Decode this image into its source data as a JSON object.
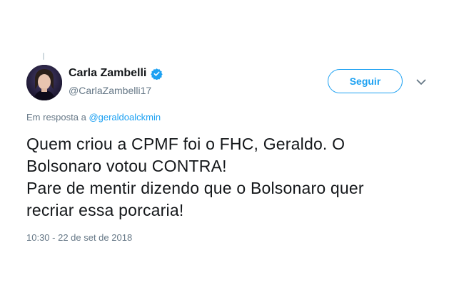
{
  "author": {
    "display_name": "Carla Zambelli",
    "handle": "@CarlaZambelli17",
    "avatar_icon": "profile-photo",
    "verified_icon": "verified-badge-icon"
  },
  "actions": {
    "follow_label": "Seguir",
    "more_icon": "chevron-down-icon"
  },
  "reply": {
    "prefix": "Em resposta a ",
    "mention": "@geraldoalckmin"
  },
  "tweet": {
    "lines": [
      "Quem criou a CPMF foi o FHC, Geraldo. O",
      "Bolsonaro votou CONTRA!",
      "Pare de mentir dizendo que o Bolsonaro quer",
      "recriar essa porcaria!"
    ]
  },
  "timestamp": "10:30 - 22 de set de 2018",
  "colors": {
    "accent": "#1da1f2",
    "text": "#14171a",
    "muted": "#657786"
  }
}
